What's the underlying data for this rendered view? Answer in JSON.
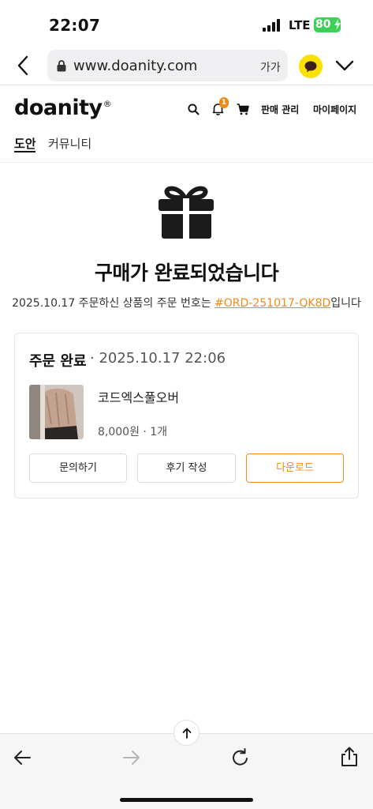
{
  "status_bar": {
    "time": "22:07",
    "network": "LTE",
    "battery": "80"
  },
  "browser": {
    "url": "www.doanity.com",
    "text_size_label": "가가"
  },
  "site": {
    "logo": "doanity",
    "logo_mark": "®",
    "notification_count": "1",
    "nav": {
      "sales_manage": "판매 관리",
      "my_page": "마이페이지"
    },
    "tabs": [
      {
        "label": "도안",
        "active": true
      },
      {
        "label": "커뮤니티",
        "active": false
      }
    ]
  },
  "main": {
    "title": "구매가 완료되었습니다",
    "message_prefix": "2025.10.17 주문하신 상품의 주문 번호는 ",
    "order_number": "#ORD-251017-QK8D",
    "message_suffix": "입니다"
  },
  "order_card": {
    "status": "주문 완료",
    "separator_date": " · 2025.10.17 22:06",
    "product_name": "코드엑스풀오버",
    "price_qty": "8,000원 · 1개",
    "buttons": {
      "inquiry": "문의하기",
      "review": "후기 작성",
      "download": "다운로드"
    }
  },
  "colors": {
    "accent": "#f08a1b",
    "kakao": "#fae100",
    "battery": "#3ecf57"
  }
}
